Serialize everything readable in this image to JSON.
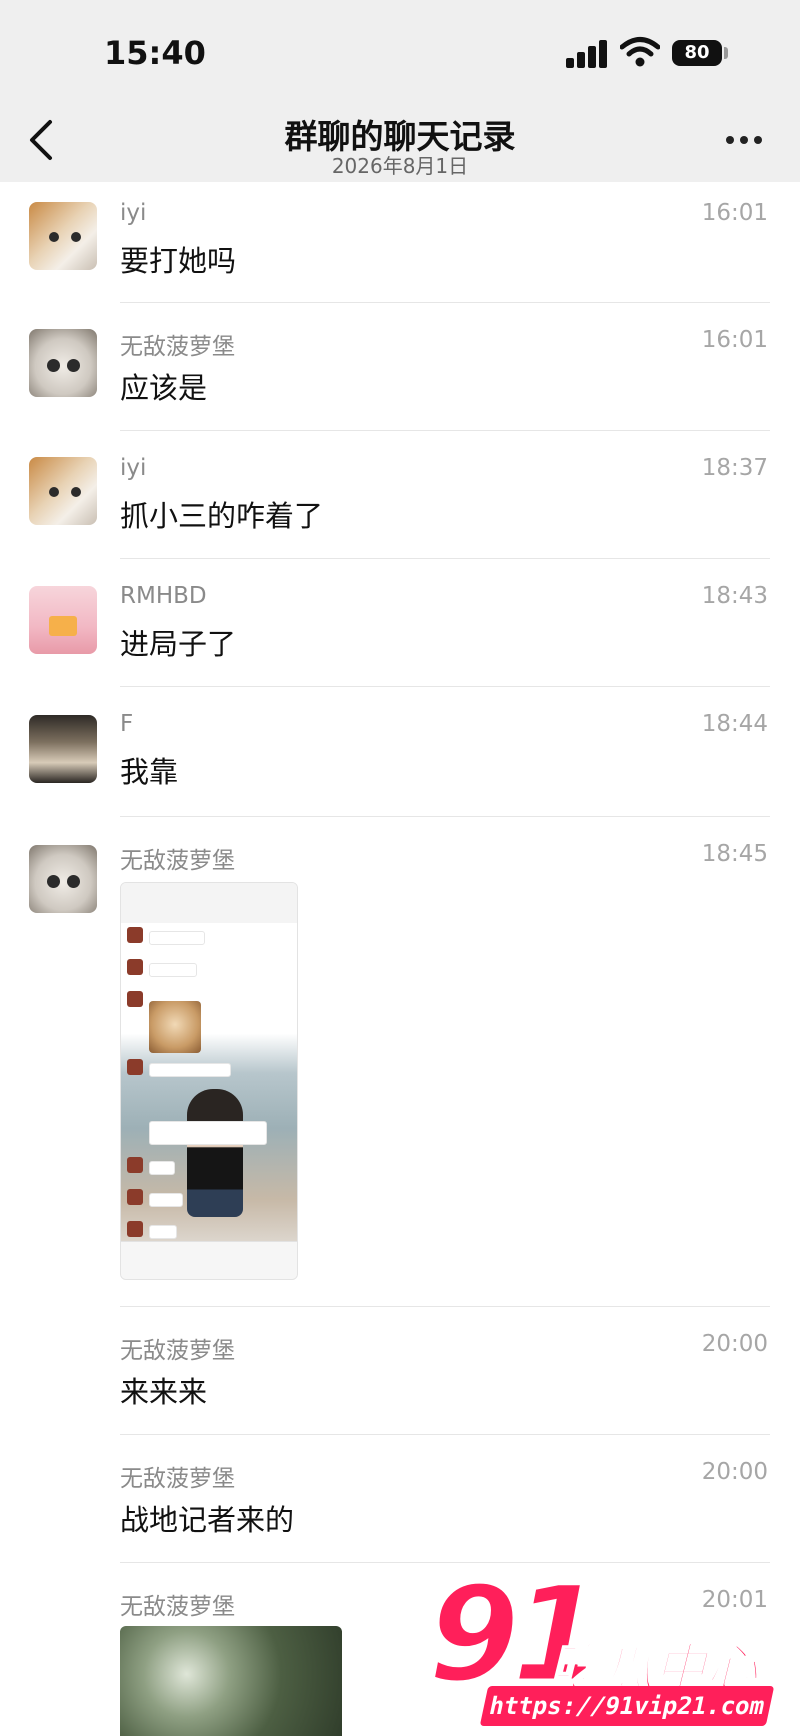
{
  "status_bar": {
    "time": "15:40",
    "battery": "80"
  },
  "nav": {
    "title": "群聊的聊天记录",
    "subtitle": "2026年8月1日",
    "back_icon": "chevron-left-icon",
    "more_icon": "ellipsis-icon"
  },
  "messages": [
    {
      "sender": "iyi",
      "time": "16:01",
      "text": "要打她吗",
      "avatar": "cat-avatar"
    },
    {
      "sender": "无敌菠萝堡",
      "time": "16:01",
      "text": "应该是",
      "avatar": "kitten-avatar"
    },
    {
      "sender": "iyi",
      "time": "18:37",
      "text": "抓小三的咋着了",
      "avatar": "cat-avatar"
    },
    {
      "sender": "RMHBD",
      "time": "18:43",
      "text": "进局子了",
      "avatar": "pink-room-avatar"
    },
    {
      "sender": "F",
      "time": "18:44",
      "text": "我靠",
      "avatar": "girl-avatar"
    },
    {
      "sender": "无敌菠萝堡",
      "time": "18:45",
      "text": "",
      "attachment": "chat-screenshot-image",
      "avatar": "kitten-avatar"
    },
    {
      "sender": "无敌菠萝堡",
      "time": "20:00",
      "text": "来来来"
    },
    {
      "sender": "无敌菠萝堡",
      "time": "20:00",
      "text": "战地记者来的"
    },
    {
      "sender": "无敌菠萝堡",
      "time": "20:01",
      "text": "",
      "attachment": "photo-image"
    }
  ],
  "watermark": {
    "logo": "91",
    "name": "吃瓜中心",
    "url": "https://91vip21.com"
  },
  "colors": {
    "nav_background": "#efefef",
    "watermark": "#ff1f5a"
  }
}
